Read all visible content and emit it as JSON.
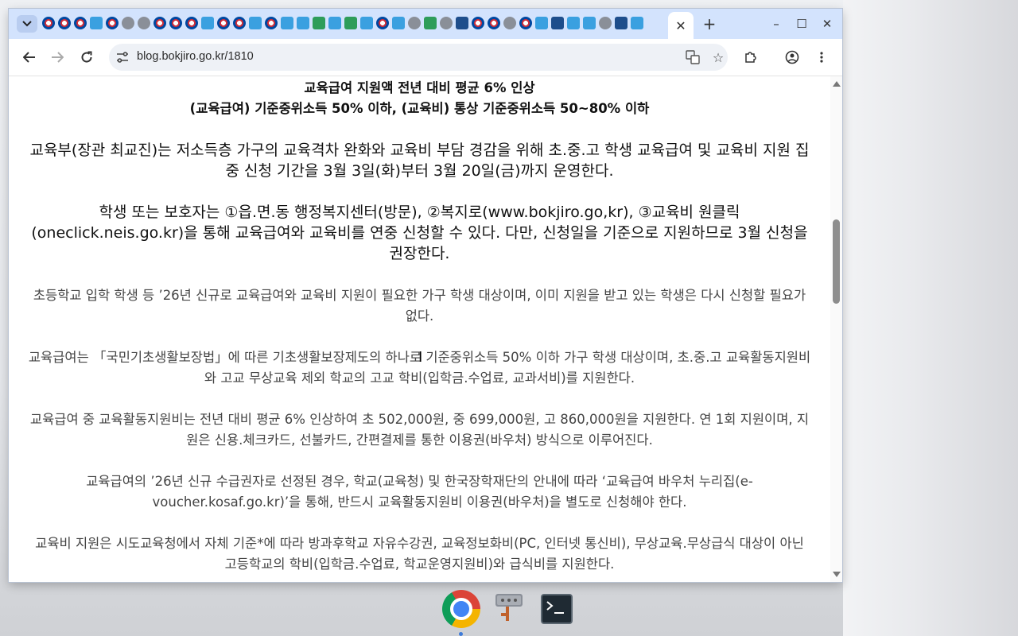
{
  "browser": {
    "active_tab_close": "✕",
    "new_tab": "+",
    "url": "blog.bokjiro.go.kr/1810",
    "window_controls": {
      "minimize": "–",
      "maximize": "☐",
      "close": "✕"
    }
  },
  "article": {
    "headline1": "교육급여 지원액 전년 대비 평균 6% 인상",
    "headline2": "(교육급여) 기준중위소득 50% 이하, (교육비) 통상 기준중위소득 50~80% 이하",
    "para1": "교육부(장관 최교진)는 저소득층 가구의 교육격차 완화와 교육비 부담 경감을 위해 초.중.고 학생 교육급여 및 교육비 지원 집중 신청 기간을 3월 3일(화)부터 3월 20일(금)까지 운영한다.",
    "para2": "학생 또는 보호자는 ①읍.면.동 행정복지센터(방문), ②복지로(www.bokjiro.go,kr), ③교육비 원클릭(oneclick.neis.go.kr)을 통해 교육급여와 교육비를 연중 신청할 수 있다. 다만, 신청일을 기준으로 지원하므로 3월 신청을 권장한다.",
    "para3": "초등학교 입학 학생 등 ’26년 신규로 교육급여와 교육비 지원이 필요한 가구 학생 대상이며, 이미 지원을 받고 있는 학생은 다시 신청할 필요가 없다.",
    "para4": "교육급여는 「국민기초생활보장법」에 따른 기초생활보장제도의 하나로 기준중위소득 50% 이하 가구 학생 대상이며, 초.중.고 교육활동지원비와 고교 무상교육 제외 학교의 고교 학비(입학금.수업료, 교과서비)를 지원한다.",
    "para5": "교육급여 중 교육활동지원비는 전년 대비 평균 6% 인상하여 초 502,000원, 중 699,000원, 고 860,000원을 지원한다. 연 1회 지원이며, 지원은 신용.체크카드, 선불카드, 간편결제를 통한 이용권(바우처) 방식으로 이루어진다.",
    "para6": "교육급여의 ’26년 신규 수급권자로 선정된 경우, 학교(교육청) 및 한국장학재단의 안내에 따라 ‘교육급여 바우처 누리집(e-voucher.kosaf.go.kr)’을 통해, 반드시 교육활동지원비 이용권(바우처)을 별도로 신청해야 한다.",
    "para7": "교육비 지원은 시도교육청에서 자체 기준*에 따라 방과후학교 자유수강권, 교육정보화비(PC, 인터넷 통신비), 무상교육.무상급식 대상이 아닌 고등학교의 학비(입학금.수업료, 학교운영지원비)와 급식비를 지원한다."
  },
  "taskbar": {
    "apps": [
      "chrome-icon",
      "network-tool-icon",
      "terminal-icon"
    ]
  }
}
